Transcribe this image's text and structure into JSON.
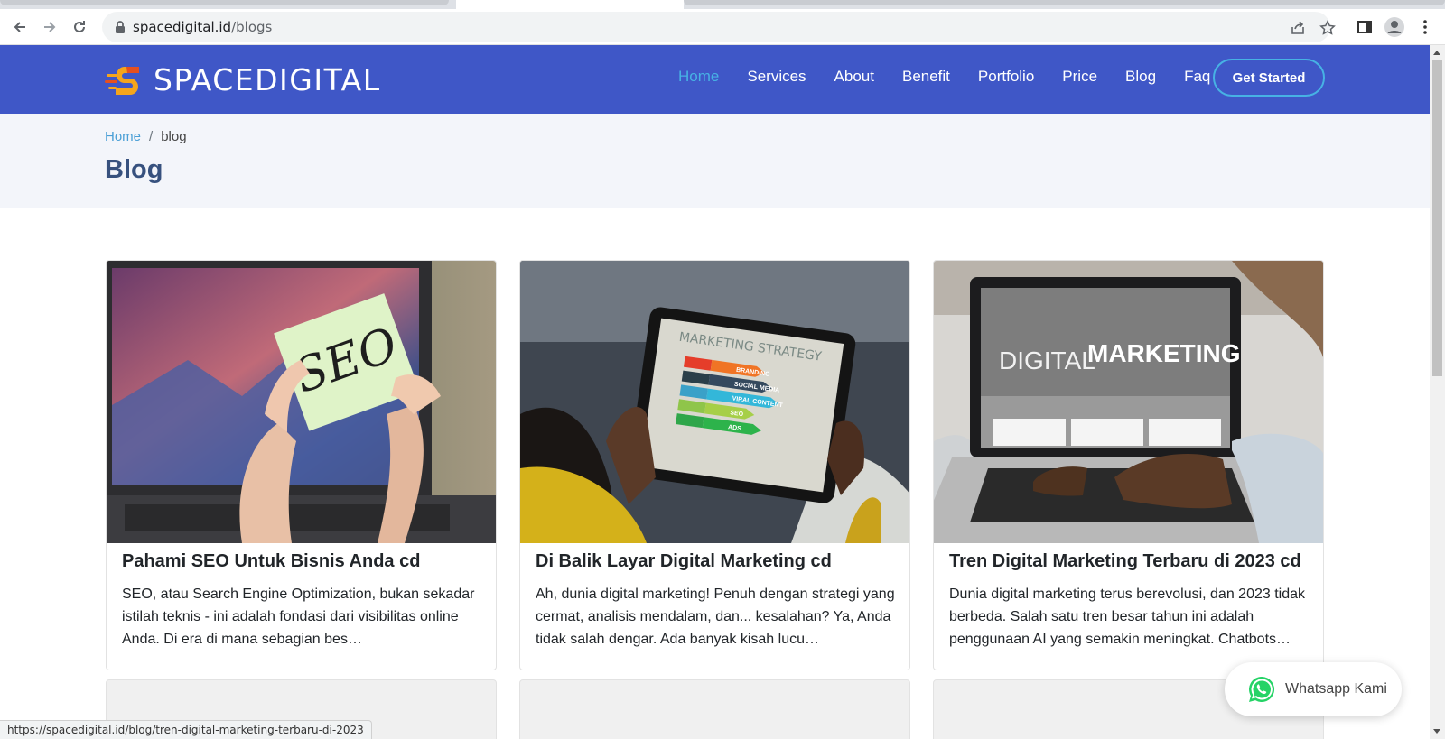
{
  "browser": {
    "url_host": "spacedigital.id",
    "url_path": "/blogs",
    "status_url": "https://spacedigital.id/blog/tren-digital-marketing-terbaru-di-2023"
  },
  "site": {
    "logo_text": "SPACEDIGITAL",
    "brand_color": "#3f57c7",
    "accent_color": "#47b2e4",
    "nav": [
      {
        "label": "Home",
        "active": true
      },
      {
        "label": "Services"
      },
      {
        "label": "About"
      },
      {
        "label": "Benefit"
      },
      {
        "label": "Portfolio"
      },
      {
        "label": "Price"
      },
      {
        "label": "Blog"
      },
      {
        "label": "Faq"
      }
    ],
    "cta_label": "Get Started"
  },
  "breadcrumb": {
    "home": "Home",
    "separator": "/",
    "current": "blog"
  },
  "page_title": "Blog",
  "posts": [
    {
      "title": "Pahami SEO Untuk Bisnis Anda cd",
      "excerpt": "SEO, atau Search Engine Optimization, bukan sekadar istilah teknis - ini adalah fondasi dari visibilitas online Anda. Di era di mana sebagian bes…",
      "image_text": "SEO"
    },
    {
      "title": "Di Balik Layar Digital Marketing cd",
      "excerpt": "Ah, dunia digital marketing! Penuh dengan strategi yang cermat, analisis mendalam, dan... kesalahan? Ya, Anda tidak salah dengar. Ada banyak kisah lucu…",
      "image_text": "MARKETING STRATEGY",
      "image_items": [
        "BRANDING",
        "SOCIAL MEDIA",
        "VIRAL CONTENT",
        "SEO",
        "ADS"
      ]
    },
    {
      "title": "Tren Digital Marketing Terbaru di 2023 cd",
      "excerpt": "Dunia digital marketing terus berevolusi, dan 2023 tidak berbeda. Salah satu tren besar tahun ini adalah penggunaan AI yang semakin meningkat. Chatbots…",
      "image_text_light": "DIGITAL",
      "image_text_bold": "MARKETING"
    }
  ],
  "whatsapp": {
    "label": "Whatsapp Kami",
    "color": "#25d366"
  }
}
